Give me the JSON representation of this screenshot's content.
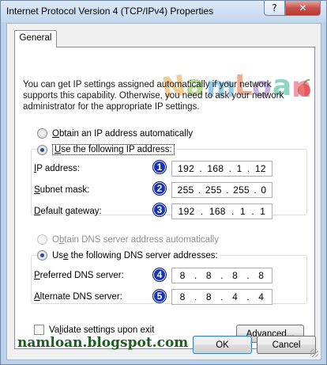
{
  "window": {
    "title": "Internet Protocol Version 4 (TCP/IPv4) Properties",
    "help_button": "?",
    "close_button": "✕"
  },
  "tabs": [
    "General"
  ],
  "watermark": {
    "text": "NamLoan"
  },
  "description": "You can get IP settings assigned automatically if your network supports this capability. Otherwise, you need to ask your network administrator for the appropriate IP settings.",
  "ip_section": {
    "auto_option": "btain an IP address automatically",
    "auto_option_key": "O",
    "manual_option": "se the following IP address:",
    "manual_option_key": "U",
    "selected": "manual",
    "fields": [
      {
        "key": "I",
        "label": "P address:",
        "badge": "1",
        "octets": [
          "192",
          "168",
          "1",
          "12"
        ]
      },
      {
        "key": "S",
        "label": "ubnet mask:",
        "badge": "2",
        "octets": [
          "255",
          "255",
          "255",
          "0"
        ]
      },
      {
        "key": "D",
        "label": "efault gateway:",
        "badge": "3",
        "octets": [
          "192",
          "168",
          "1",
          "1"
        ]
      }
    ]
  },
  "dns_section": {
    "auto_option_pre": "O",
    "auto_option_key": "b",
    "auto_option_post": "tain DNS server address automatically",
    "manual_option_pre": "Us",
    "manual_option_key": "e",
    "manual_option_post": " the following DNS server addresses:",
    "selected": "manual",
    "fields": [
      {
        "key": "P",
        "label": "referred DNS server:",
        "badge": "4",
        "octets": [
          "8",
          "8",
          "8",
          "8"
        ]
      },
      {
        "key": "A",
        "label": "lternate DNS server:",
        "badge": "5",
        "octets": [
          "8",
          "8",
          "4",
          "4"
        ]
      }
    ]
  },
  "validate_checkbox": {
    "pre": "Va",
    "key": "l",
    "post": "idate settings upon exit",
    "checked": false
  },
  "buttons": {
    "advanced_pre": "Ad",
    "advanced_key": "v",
    "advanced_post": "anced...",
    "ok": "OK",
    "cancel": "Cancel"
  },
  "footer": {
    "blog": "namloan.blogspot.com"
  },
  "colors": {
    "badge": "#1633b8",
    "blog_text": "#1b5e20"
  }
}
